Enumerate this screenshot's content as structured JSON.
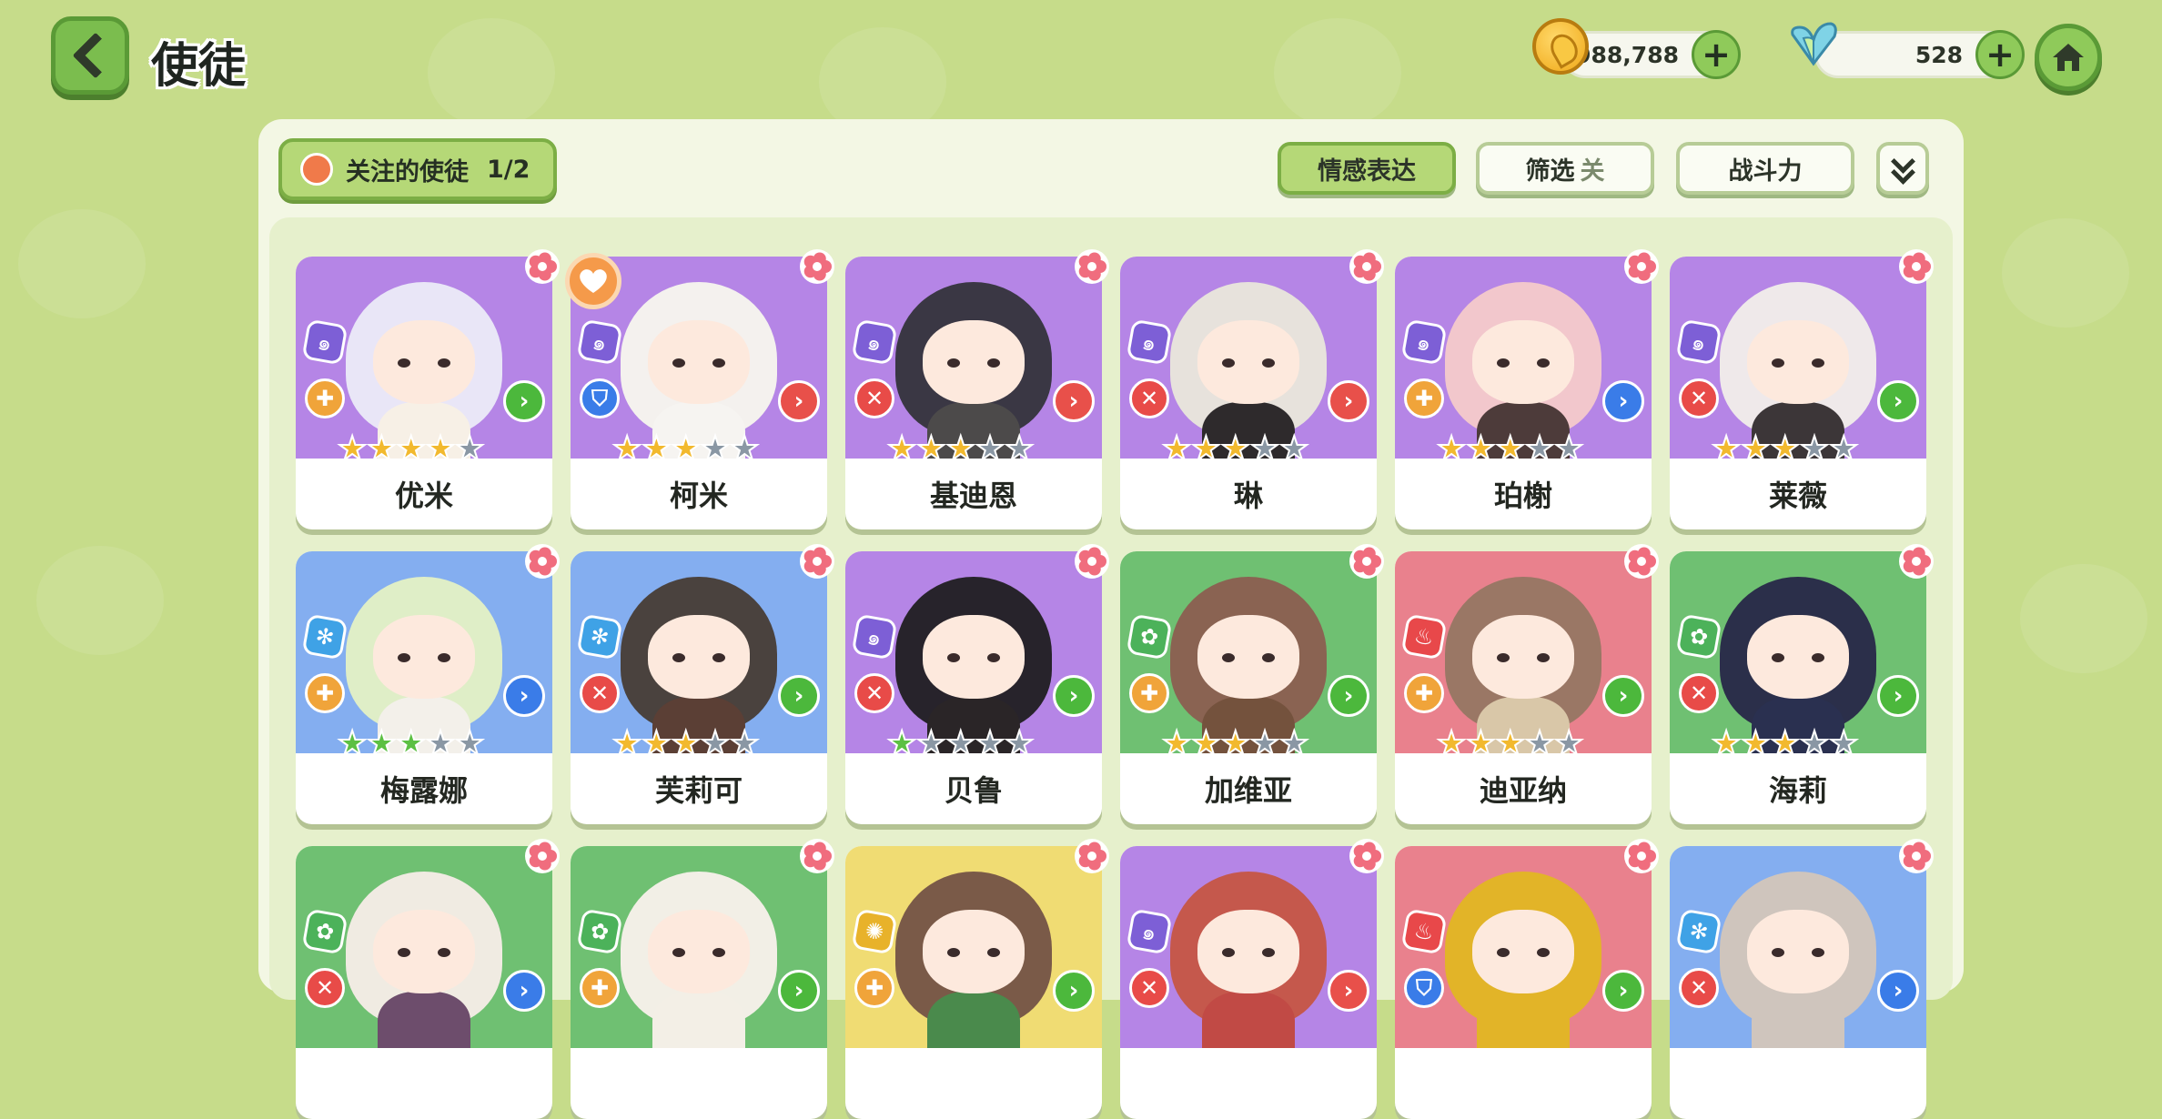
{
  "header": {
    "title": "使徒"
  },
  "resources": {
    "coins": "988,788",
    "gems": "528"
  },
  "toolbar": {
    "follow_label": "关注的使徒",
    "follow_count": "1/2",
    "emotion_label": "情感表达",
    "filter_label": "筛选",
    "filter_state": "关",
    "power_label": "战斗力"
  },
  "cards": [
    {
      "name": "优米",
      "bg": "purple",
      "element": "b-psy",
      "role": "r-or",
      "arrow": "a-green",
      "stars": "yyyyg",
      "fav": false
    },
    {
      "name": "柯米",
      "bg": "purple",
      "element": "b-psy",
      "role": "r-blue",
      "arrow": "a-red",
      "stars": "yyygg",
      "fav": true
    },
    {
      "name": "基迪恩",
      "bg": "purple",
      "element": "b-psy",
      "role": "r-red",
      "arrow": "a-red",
      "stars": "yyygg",
      "fav": false
    },
    {
      "name": "琳",
      "bg": "purple",
      "element": "b-psy",
      "role": "r-red",
      "arrow": "a-red",
      "stars": "yyygg",
      "fav": false
    },
    {
      "name": "珀榭",
      "bg": "purple",
      "element": "b-psy",
      "role": "r-or",
      "arrow": "a-blue",
      "stars": "yyygg",
      "fav": false
    },
    {
      "name": "莱薇",
      "bg": "purple",
      "element": "b-psy",
      "role": "r-red",
      "arrow": "a-green",
      "stars": "yyygg",
      "fav": false
    },
    {
      "name": "梅露娜",
      "bg": "blue",
      "element": "b-ice",
      "role": "r-or",
      "arrow": "a-blue",
      "stars": "GGGgg",
      "fav": false
    },
    {
      "name": "芙莉可",
      "bg": "blue",
      "element": "b-ice",
      "role": "r-red",
      "arrow": "a-green",
      "stars": "yyygg",
      "fav": false
    },
    {
      "name": "贝鲁",
      "bg": "purple",
      "element": "b-psy",
      "role": "r-red",
      "arrow": "a-green",
      "stars": "Ggggg",
      "fav": false
    },
    {
      "name": "加维亚",
      "bg": "green",
      "element": "b-leaf",
      "role": "r-or",
      "arrow": "a-green",
      "stars": "yyygg",
      "fav": false
    },
    {
      "name": "迪亚纳",
      "bg": "pink",
      "element": "b-fire",
      "role": "r-or",
      "arrow": "a-green",
      "stars": "yyygg",
      "fav": false
    },
    {
      "name": "海莉",
      "bg": "green",
      "element": "b-leaf",
      "role": "r-red",
      "arrow": "a-green",
      "stars": "yyygg",
      "fav": false
    },
    {
      "name": "",
      "bg": "green",
      "element": "b-leaf",
      "role": "r-red",
      "arrow": "a-blue",
      "stars": "",
      "fav": false
    },
    {
      "name": "",
      "bg": "green",
      "element": "b-leaf",
      "role": "r-or",
      "arrow": "a-green",
      "stars": "",
      "fav": false
    },
    {
      "name": "",
      "bg": "yellow",
      "element": "b-sun",
      "role": "r-or",
      "arrow": "a-green",
      "stars": "",
      "fav": false
    },
    {
      "name": "",
      "bg": "purple",
      "element": "b-psy",
      "role": "r-red",
      "arrow": "a-red",
      "stars": "",
      "fav": false
    },
    {
      "name": "",
      "bg": "pink",
      "element": "b-fire",
      "role": "r-blue",
      "arrow": "a-green",
      "stars": "",
      "fav": false
    },
    {
      "name": "",
      "bg": "blue",
      "element": "b-ice",
      "role": "r-red",
      "arrow": "a-blue",
      "stars": "",
      "fav": false
    }
  ],
  "icons": {
    "back": "chevron-left-icon",
    "home": "home-icon",
    "coin": "coin-icon",
    "gem": "gem-icon",
    "add": "plus-icon",
    "expand": "double-chevron-down-icon",
    "heart": "heart-icon",
    "flower": "flower-icon"
  }
}
